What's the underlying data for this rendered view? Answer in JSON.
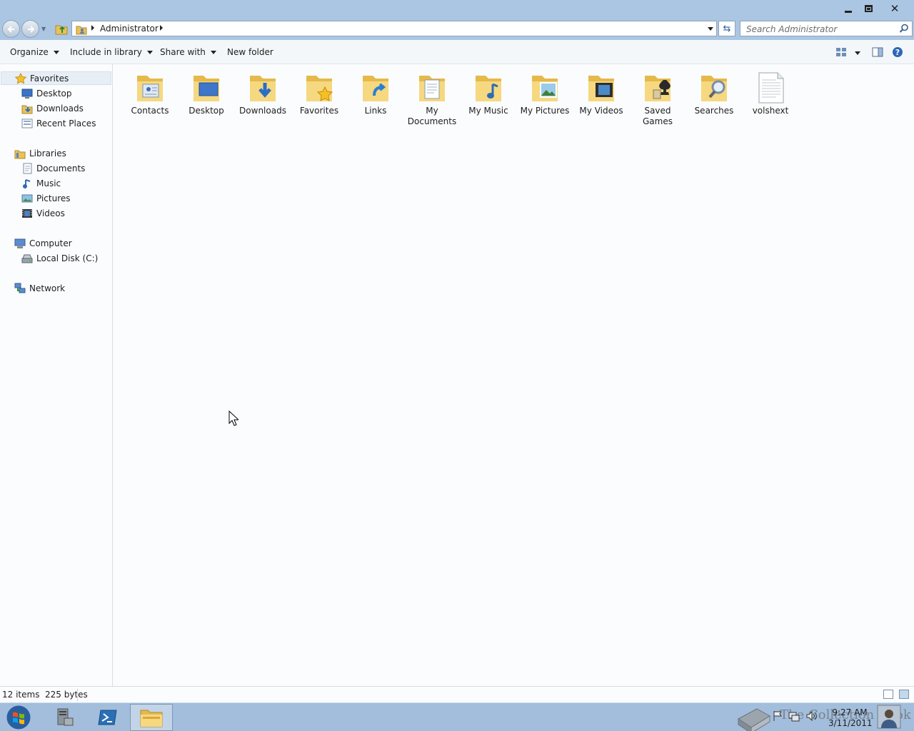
{
  "window": {
    "controls": {
      "minimize": "minimize-icon",
      "maximize": "restore-icon",
      "close": "close-icon"
    }
  },
  "address": {
    "breadcrumb": [
      "Administrator"
    ],
    "search_placeholder": "Search Administrator"
  },
  "toolbar": {
    "organize": "Organize",
    "include_in_library": "Include in library",
    "share_with": "Share with",
    "new_folder": "New folder"
  },
  "navpane": {
    "favorites": {
      "label": "Favorites",
      "items": [
        "Desktop",
        "Downloads",
        "Recent Places"
      ]
    },
    "libraries": {
      "label": "Libraries",
      "items": [
        "Documents",
        "Music",
        "Pictures",
        "Videos"
      ]
    },
    "computer": {
      "label": "Computer",
      "items": [
        "Local Disk (C:)"
      ]
    },
    "network": {
      "label": "Network"
    }
  },
  "files": [
    {
      "name": "Contacts",
      "lines": [
        "Contacts"
      ],
      "icon": "contacts-folder-icon"
    },
    {
      "name": "Desktop",
      "lines": [
        "Desktop"
      ],
      "icon": "desktop-folder-icon"
    },
    {
      "name": "Downloads",
      "lines": [
        "Downloads"
      ],
      "icon": "downloads-folder-icon"
    },
    {
      "name": "Favorites",
      "lines": [
        "Favorites"
      ],
      "icon": "favorites-folder-icon"
    },
    {
      "name": "Links",
      "lines": [
        "Links"
      ],
      "icon": "links-folder-icon"
    },
    {
      "name": "My Documents",
      "lines": [
        "My",
        "Documents"
      ],
      "icon": "documents-folder-icon"
    },
    {
      "name": "My Music",
      "lines": [
        "My Music"
      ],
      "icon": "music-folder-icon"
    },
    {
      "name": "My Pictures",
      "lines": [
        "My Pictures"
      ],
      "icon": "pictures-folder-icon"
    },
    {
      "name": "My Videos",
      "lines": [
        "My Videos"
      ],
      "icon": "videos-folder-icon"
    },
    {
      "name": "Saved Games",
      "lines": [
        "Saved",
        "Games"
      ],
      "icon": "saved-games-folder-icon"
    },
    {
      "name": "Searches",
      "lines": [
        "Searches"
      ],
      "icon": "searches-folder-icon"
    },
    {
      "name": "volshext",
      "lines": [
        "volshext"
      ],
      "icon": "text-file-icon"
    }
  ],
  "status": {
    "items": "12 items",
    "size": "225 bytes"
  },
  "taskbar": {
    "clock_time": "9:27 AM",
    "clock_date": "3/11/2011",
    "watermark": "The Collection Book"
  }
}
